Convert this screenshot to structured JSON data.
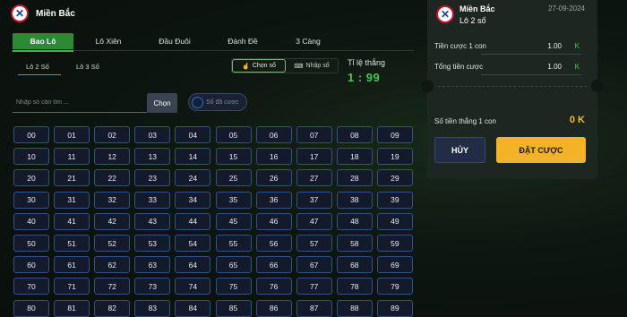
{
  "header": {
    "title": "Miền Bắc"
  },
  "tabs": [
    {
      "label": "Bao Lô"
    },
    {
      "label": "Lô Xiên"
    },
    {
      "label": "Đầu Đuôi"
    },
    {
      "label": "Đánh Đề"
    },
    {
      "label": "3 Càng"
    }
  ],
  "subtabs": [
    {
      "label": "Lô 2 Số"
    },
    {
      "label": "Lô 3 Số"
    }
  ],
  "mode": {
    "choose_label": "Chọn số",
    "input_label": "Nhập số"
  },
  "ratio": {
    "label": "Tỉ lệ thắng",
    "value": "1 : 99"
  },
  "search": {
    "placeholder": "Nhập số cần tìm ...",
    "button_label": "Chọn"
  },
  "bet_toggle": {
    "label": "Số đã cược"
  },
  "numbers": [
    "00",
    "01",
    "02",
    "03",
    "04",
    "05",
    "06",
    "07",
    "08",
    "09",
    "10",
    "11",
    "12",
    "13",
    "14",
    "15",
    "16",
    "17",
    "18",
    "19",
    "20",
    "21",
    "22",
    "23",
    "24",
    "25",
    "26",
    "27",
    "28",
    "29",
    "30",
    "31",
    "32",
    "33",
    "34",
    "35",
    "36",
    "37",
    "38",
    "39",
    "40",
    "41",
    "42",
    "43",
    "44",
    "45",
    "46",
    "47",
    "48",
    "49",
    "50",
    "51",
    "52",
    "53",
    "54",
    "55",
    "56",
    "57",
    "58",
    "59",
    "60",
    "61",
    "62",
    "63",
    "64",
    "65",
    "66",
    "67",
    "68",
    "69",
    "70",
    "71",
    "72",
    "73",
    "74",
    "75",
    "76",
    "77",
    "78",
    "79",
    "80",
    "81",
    "82",
    "83",
    "84",
    "85",
    "86",
    "87",
    "88",
    "89"
  ],
  "ticket": {
    "region": "Miền Bắc",
    "date": "27-09-2024",
    "type": "Lô 2 số",
    "stake_label": "Tiền cược 1 con",
    "stake_value": "1.00",
    "stake_unit": "K",
    "total_label": "Tổng tiền cược",
    "total_value": "1.00",
    "total_unit": "K",
    "win_label": "Số tiền thắng 1 con",
    "win_value": "0 K",
    "cancel_label": "HỦY",
    "bet_label": "ĐẶT CƯỢC"
  },
  "colors": {
    "accent_green": "#3ecb4d",
    "tab_active": "#2a8a36",
    "bet_button": "#f4b227",
    "number_border": "#35527f"
  }
}
